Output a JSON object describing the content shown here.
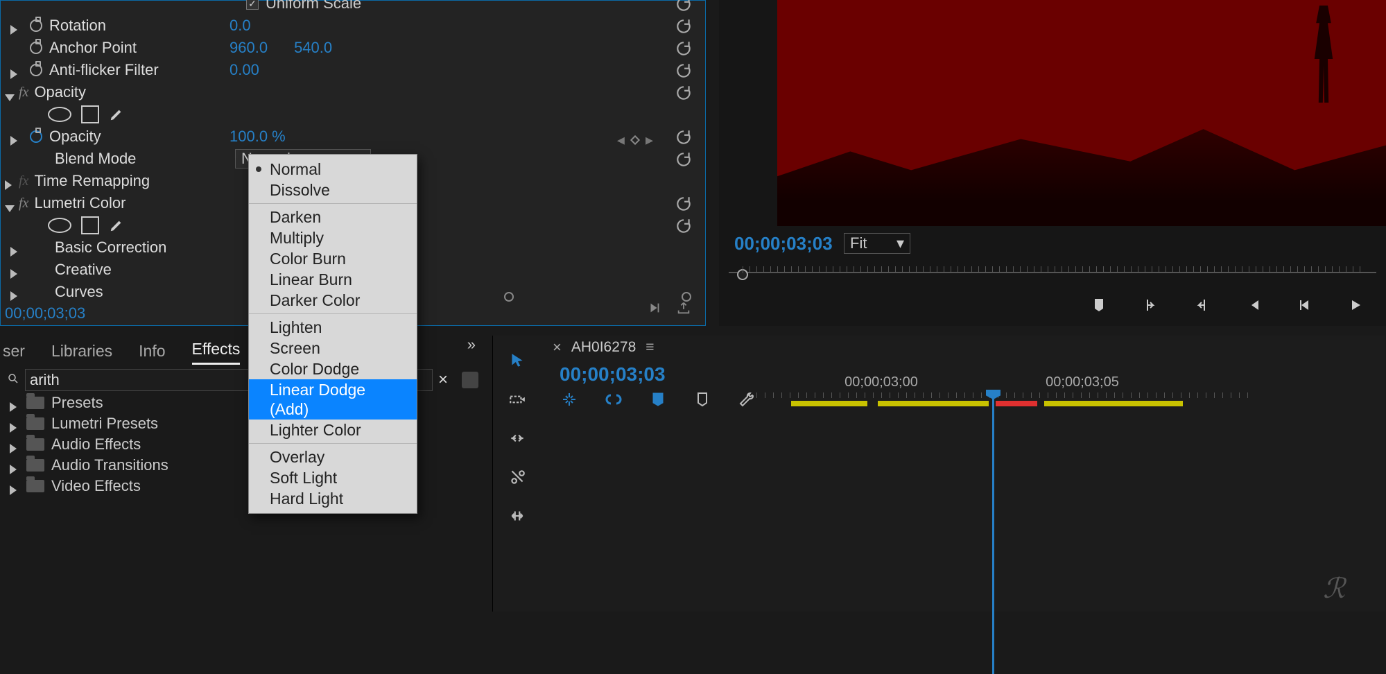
{
  "effects_panel": {
    "uniform_scale_label": "Uniform Scale",
    "rotation": {
      "label": "Rotation",
      "value": "0.0"
    },
    "anchor_point": {
      "label": "Anchor Point",
      "x": "960.0",
      "y": "540.0"
    },
    "anti_flicker": {
      "label": "Anti-flicker Filter",
      "value": "0.00"
    },
    "opacity_group": {
      "label": "Opacity"
    },
    "opacity_prop": {
      "label": "Opacity",
      "value": "100.0 %"
    },
    "blend_mode": {
      "label": "Blend Mode",
      "selected": "Normal"
    },
    "time_remapping": {
      "label": "Time Remapping"
    },
    "lumetri": {
      "label": "Lumetri Color",
      "sections": [
        "Basic Correction",
        "Creative",
        "Curves"
      ]
    },
    "timecode": "00;00;03;03"
  },
  "blend_mode_menu": {
    "groups": [
      [
        "Normal",
        "Dissolve"
      ],
      [
        "Darken",
        "Multiply",
        "Color Burn",
        "Linear Burn",
        "Darker Color"
      ],
      [
        "Lighten",
        "Screen",
        "Color Dodge",
        "Linear Dodge (Add)",
        "Lighter Color"
      ],
      [
        "Overlay",
        "Soft Light",
        "Hard Light"
      ]
    ],
    "current": "Normal",
    "highlight": "Linear Dodge (Add)"
  },
  "tabs": {
    "items": [
      "ser",
      "Libraries",
      "Info",
      "Effects"
    ],
    "active": "Effects"
  },
  "search": {
    "value": "arith"
  },
  "effects_tree": [
    "Presets",
    "Lumetri Presets",
    "Audio Effects",
    "Audio Transitions",
    "Video Effects"
  ],
  "program_monitor": {
    "timecode": "00;00;03;03",
    "fit_label": "Fit"
  },
  "timeline": {
    "sequence_name": "AH0I6278",
    "timecode": "00;00;03;03",
    "ruler_times": [
      "00;00;03;00",
      "00;00;03;05"
    ]
  }
}
